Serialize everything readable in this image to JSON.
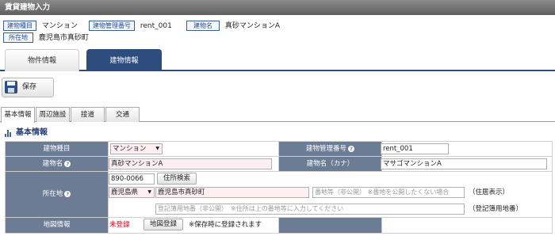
{
  "window_title": "賃貸建物入力",
  "meta": {
    "type_label": "建物種目",
    "type_value": "マンション",
    "id_label": "建物管理番号",
    "id_value": "rent_001",
    "name_label": "建物名",
    "name_value": "真砂マンションA",
    "addr_label": "所在地",
    "addr_value": "鹿児島市真砂町"
  },
  "main_tabs": [
    {
      "label": "物件情報",
      "active": false
    },
    {
      "label": "建物情報",
      "active": true
    }
  ],
  "toolbar": {
    "save_label": "保存"
  },
  "sub_tabs": [
    {
      "label": "基本情報",
      "active": true
    },
    {
      "label": "周辺施設",
      "active": false
    },
    {
      "label": "接道",
      "active": false
    },
    {
      "label": "交通",
      "active": false
    }
  ],
  "section_title": "基本情報",
  "form": {
    "type_label": "建物種目",
    "type_value": "マンション",
    "id_label": "建物管理番号",
    "id_value": "rent_001",
    "name_label": "建物名",
    "name_value": "真砂マンションA",
    "kana_label": "建物名（カナ）",
    "kana_value": "マサゴマンションA",
    "addr_label": "所在地",
    "zip_value": "890-0066",
    "addr_search_label": "住所検索",
    "pref_value": "鹿児島県",
    "city_value": "鹿児島市真砂町",
    "lot_placeholder": "番地等（非公開） ※番地を公開したくない場合",
    "lot_note": "（住居表示）",
    "reg_placeholder": "登記簿用地番（非公開）　※住所は上の番地等に入力してください",
    "reg_note": "（登記簿用地番）",
    "map_label": "地図情報",
    "map_status": "未登録",
    "map_button": "地図登録",
    "map_note": "※保存時に登録されます"
  },
  "colors": {
    "label_bg": "#6d7c95",
    "accent": "#2d4d7e",
    "required_bg": "#fdeef2",
    "unregistered": "#d0021b"
  }
}
